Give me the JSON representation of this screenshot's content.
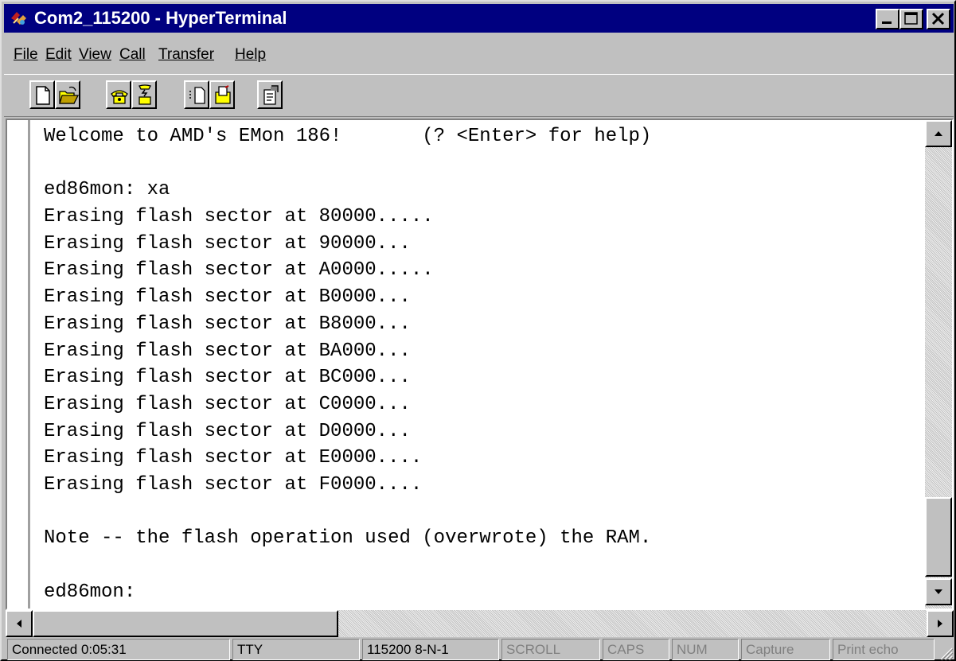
{
  "window": {
    "title": "Com2_115200 - HyperTerminal",
    "titlebar_color": "#000080"
  },
  "menu": [
    "File",
    "Edit",
    "View",
    "Call",
    "Transfer",
    "Help"
  ],
  "toolbar": {
    "icons": [
      "new-document-icon",
      "open-folder-icon",
      "call-phone-icon",
      "disconnect-phone-icon",
      "send-file-icon",
      "receive-file-icon",
      "properties-icon"
    ]
  },
  "terminal": {
    "lines": [
      "Welcome to AMD's EMon 186!       (? <Enter> for help)",
      "",
      "ed86mon: xa",
      "Erasing flash sector at 80000.....",
      "Erasing flash sector at 90000...",
      "Erasing flash sector at A0000.....",
      "Erasing flash sector at B0000...",
      "Erasing flash sector at B8000...",
      "Erasing flash sector at BA000...",
      "Erasing flash sector at BC000...",
      "Erasing flash sector at C0000...",
      "Erasing flash sector at D0000...",
      "Erasing flash sector at E0000....",
      "Erasing flash sector at F0000....",
      "",
      "Note -- the flash operation used (overwrote) the RAM.",
      "",
      "ed86mon:"
    ]
  },
  "status": {
    "connected": "Connected 0:05:31",
    "emulation": "TTY",
    "settings": "115200 8-N-1",
    "scroll": "SCROLL",
    "caps": "CAPS",
    "num": "NUM",
    "capture": "Capture",
    "print_echo": "Print echo"
  }
}
